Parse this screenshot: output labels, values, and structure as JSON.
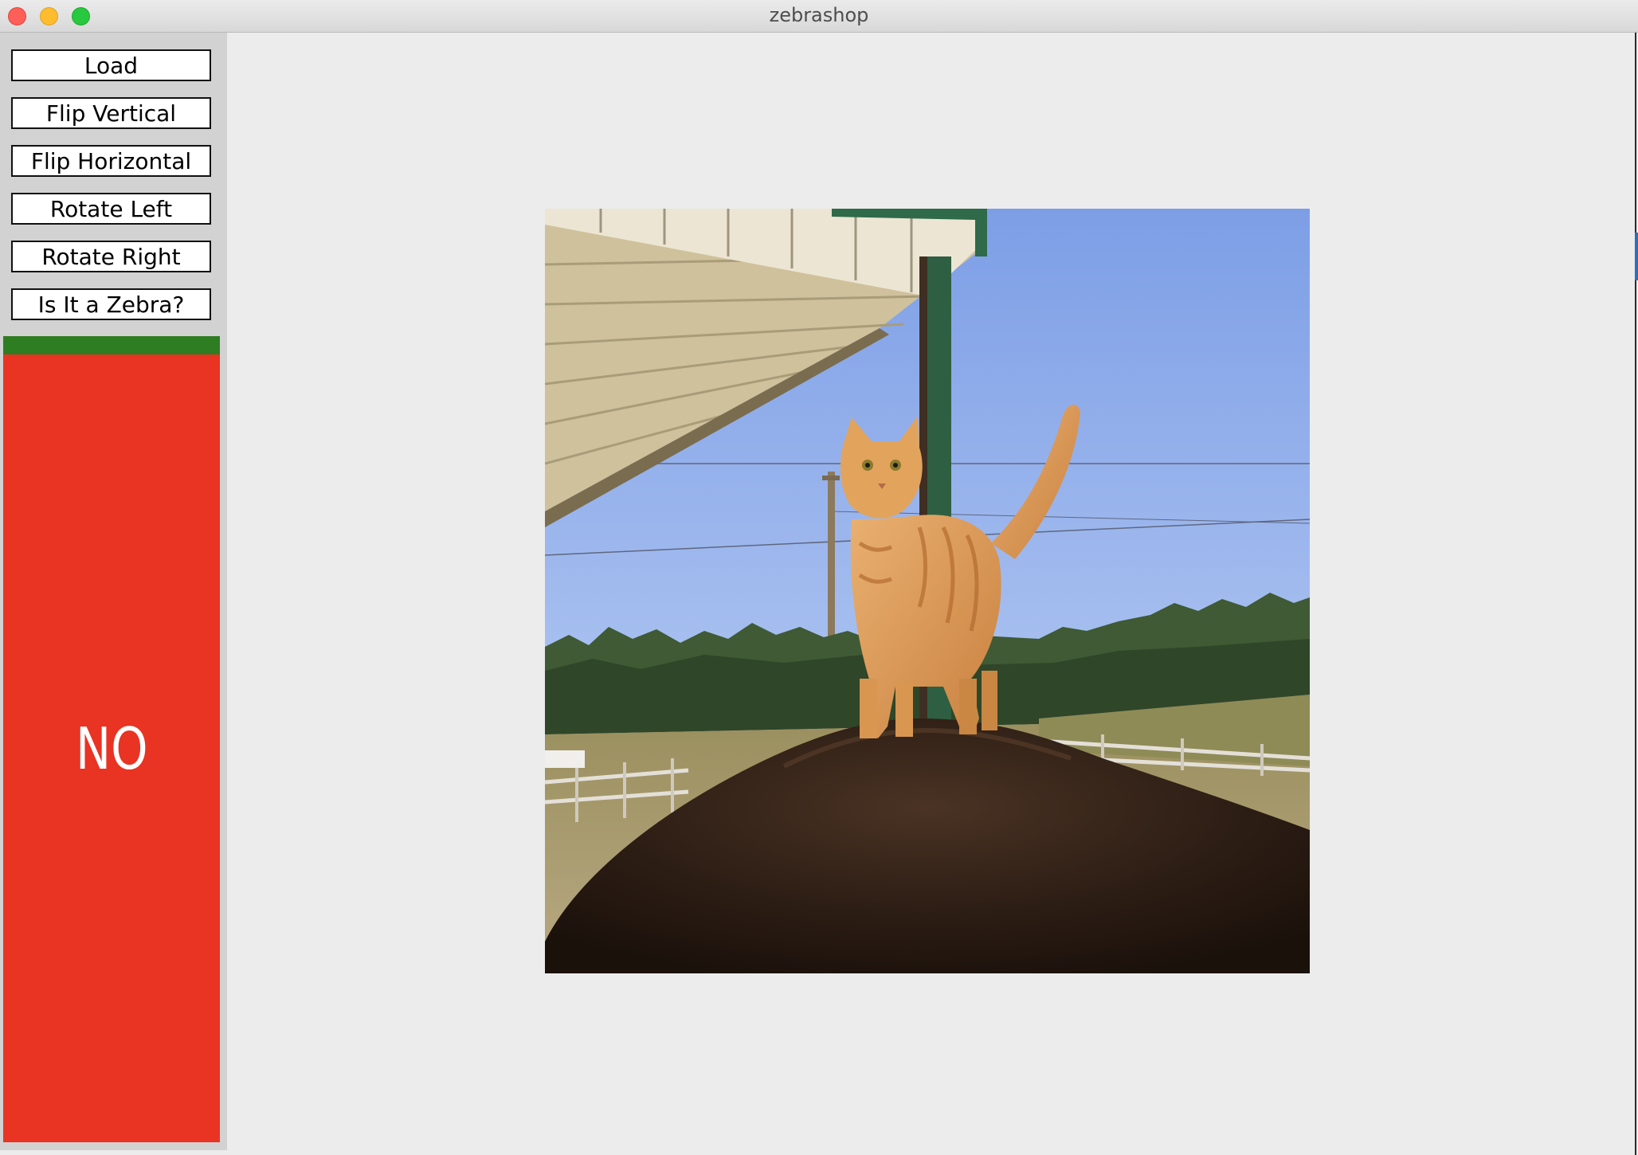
{
  "window": {
    "title": "zebrashop"
  },
  "sidebar": {
    "buttons": [
      {
        "label": "Load"
      },
      {
        "label": "Flip Vertical"
      },
      {
        "label": "Flip Horizontal"
      },
      {
        "label": "Rotate Left"
      },
      {
        "label": "Rotate Right"
      },
      {
        "label": "Is It a Zebra?"
      }
    ],
    "result": {
      "text": "NO",
      "colors": {
        "indicator": "#2f7d22",
        "panel": "#e93323"
      }
    }
  },
  "canvas": {
    "image_subject": "orange tabby cat standing on the back of a dark brown horse under a barn roof with pine trees and blue sky"
  },
  "colors": {
    "titlebar": "#e2e2e2",
    "background": "#ececec",
    "sidebar": "#d2d2d2"
  }
}
